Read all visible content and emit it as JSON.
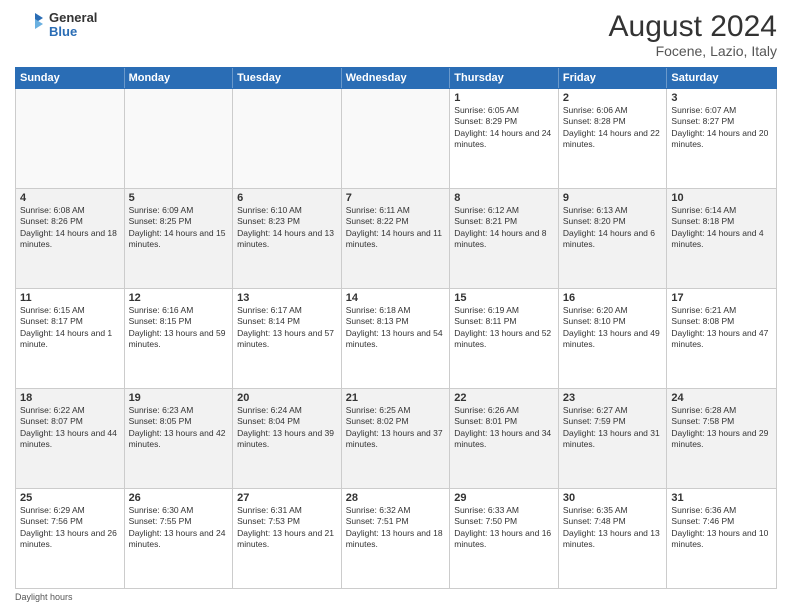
{
  "logo": {
    "general": "General",
    "blue": "Blue"
  },
  "title": "August 2024",
  "subtitle": "Focene, Lazio, Italy",
  "days_header": [
    "Sunday",
    "Monday",
    "Tuesday",
    "Wednesday",
    "Thursday",
    "Friday",
    "Saturday"
  ],
  "weeks": [
    [
      {
        "day": "",
        "sunrise": "",
        "sunset": "",
        "daylight": "",
        "empty": true
      },
      {
        "day": "",
        "sunrise": "",
        "sunset": "",
        "daylight": "",
        "empty": true
      },
      {
        "day": "",
        "sunrise": "",
        "sunset": "",
        "daylight": "",
        "empty": true
      },
      {
        "day": "",
        "sunrise": "",
        "sunset": "",
        "daylight": "",
        "empty": true
      },
      {
        "day": "1",
        "sunrise": "Sunrise: 6:05 AM",
        "sunset": "Sunset: 8:29 PM",
        "daylight": "Daylight: 14 hours and 24 minutes."
      },
      {
        "day": "2",
        "sunrise": "Sunrise: 6:06 AM",
        "sunset": "Sunset: 8:28 PM",
        "daylight": "Daylight: 14 hours and 22 minutes."
      },
      {
        "day": "3",
        "sunrise": "Sunrise: 6:07 AM",
        "sunset": "Sunset: 8:27 PM",
        "daylight": "Daylight: 14 hours and 20 minutes."
      }
    ],
    [
      {
        "day": "4",
        "sunrise": "Sunrise: 6:08 AM",
        "sunset": "Sunset: 8:26 PM",
        "daylight": "Daylight: 14 hours and 18 minutes."
      },
      {
        "day": "5",
        "sunrise": "Sunrise: 6:09 AM",
        "sunset": "Sunset: 8:25 PM",
        "daylight": "Daylight: 14 hours and 15 minutes."
      },
      {
        "day": "6",
        "sunrise": "Sunrise: 6:10 AM",
        "sunset": "Sunset: 8:23 PM",
        "daylight": "Daylight: 14 hours and 13 minutes."
      },
      {
        "day": "7",
        "sunrise": "Sunrise: 6:11 AM",
        "sunset": "Sunset: 8:22 PM",
        "daylight": "Daylight: 14 hours and 11 minutes."
      },
      {
        "day": "8",
        "sunrise": "Sunrise: 6:12 AM",
        "sunset": "Sunset: 8:21 PM",
        "daylight": "Daylight: 14 hours and 8 minutes."
      },
      {
        "day": "9",
        "sunrise": "Sunrise: 6:13 AM",
        "sunset": "Sunset: 8:20 PM",
        "daylight": "Daylight: 14 hours and 6 minutes."
      },
      {
        "day": "10",
        "sunrise": "Sunrise: 6:14 AM",
        "sunset": "Sunset: 8:18 PM",
        "daylight": "Daylight: 14 hours and 4 minutes."
      }
    ],
    [
      {
        "day": "11",
        "sunrise": "Sunrise: 6:15 AM",
        "sunset": "Sunset: 8:17 PM",
        "daylight": "Daylight: 14 hours and 1 minute."
      },
      {
        "day": "12",
        "sunrise": "Sunrise: 6:16 AM",
        "sunset": "Sunset: 8:15 PM",
        "daylight": "Daylight: 13 hours and 59 minutes."
      },
      {
        "day": "13",
        "sunrise": "Sunrise: 6:17 AM",
        "sunset": "Sunset: 8:14 PM",
        "daylight": "Daylight: 13 hours and 57 minutes."
      },
      {
        "day": "14",
        "sunrise": "Sunrise: 6:18 AM",
        "sunset": "Sunset: 8:13 PM",
        "daylight": "Daylight: 13 hours and 54 minutes."
      },
      {
        "day": "15",
        "sunrise": "Sunrise: 6:19 AM",
        "sunset": "Sunset: 8:11 PM",
        "daylight": "Daylight: 13 hours and 52 minutes."
      },
      {
        "day": "16",
        "sunrise": "Sunrise: 6:20 AM",
        "sunset": "Sunset: 8:10 PM",
        "daylight": "Daylight: 13 hours and 49 minutes."
      },
      {
        "day": "17",
        "sunrise": "Sunrise: 6:21 AM",
        "sunset": "Sunset: 8:08 PM",
        "daylight": "Daylight: 13 hours and 47 minutes."
      }
    ],
    [
      {
        "day": "18",
        "sunrise": "Sunrise: 6:22 AM",
        "sunset": "Sunset: 8:07 PM",
        "daylight": "Daylight: 13 hours and 44 minutes."
      },
      {
        "day": "19",
        "sunrise": "Sunrise: 6:23 AM",
        "sunset": "Sunset: 8:05 PM",
        "daylight": "Daylight: 13 hours and 42 minutes."
      },
      {
        "day": "20",
        "sunrise": "Sunrise: 6:24 AM",
        "sunset": "Sunset: 8:04 PM",
        "daylight": "Daylight: 13 hours and 39 minutes."
      },
      {
        "day": "21",
        "sunrise": "Sunrise: 6:25 AM",
        "sunset": "Sunset: 8:02 PM",
        "daylight": "Daylight: 13 hours and 37 minutes."
      },
      {
        "day": "22",
        "sunrise": "Sunrise: 6:26 AM",
        "sunset": "Sunset: 8:01 PM",
        "daylight": "Daylight: 13 hours and 34 minutes."
      },
      {
        "day": "23",
        "sunrise": "Sunrise: 6:27 AM",
        "sunset": "Sunset: 7:59 PM",
        "daylight": "Daylight: 13 hours and 31 minutes."
      },
      {
        "day": "24",
        "sunrise": "Sunrise: 6:28 AM",
        "sunset": "Sunset: 7:58 PM",
        "daylight": "Daylight: 13 hours and 29 minutes."
      }
    ],
    [
      {
        "day": "25",
        "sunrise": "Sunrise: 6:29 AM",
        "sunset": "Sunset: 7:56 PM",
        "daylight": "Daylight: 13 hours and 26 minutes."
      },
      {
        "day": "26",
        "sunrise": "Sunrise: 6:30 AM",
        "sunset": "Sunset: 7:55 PM",
        "daylight": "Daylight: 13 hours and 24 minutes."
      },
      {
        "day": "27",
        "sunrise": "Sunrise: 6:31 AM",
        "sunset": "Sunset: 7:53 PM",
        "daylight": "Daylight: 13 hours and 21 minutes."
      },
      {
        "day": "28",
        "sunrise": "Sunrise: 6:32 AM",
        "sunset": "Sunset: 7:51 PM",
        "daylight": "Daylight: 13 hours and 18 minutes."
      },
      {
        "day": "29",
        "sunrise": "Sunrise: 6:33 AM",
        "sunset": "Sunset: 7:50 PM",
        "daylight": "Daylight: 13 hours and 16 minutes."
      },
      {
        "day": "30",
        "sunrise": "Sunrise: 6:35 AM",
        "sunset": "Sunset: 7:48 PM",
        "daylight": "Daylight: 13 hours and 13 minutes."
      },
      {
        "day": "31",
        "sunrise": "Sunrise: 6:36 AM",
        "sunset": "Sunset: 7:46 PM",
        "daylight": "Daylight: 13 hours and 10 minutes."
      }
    ]
  ],
  "footer": "Daylight hours"
}
